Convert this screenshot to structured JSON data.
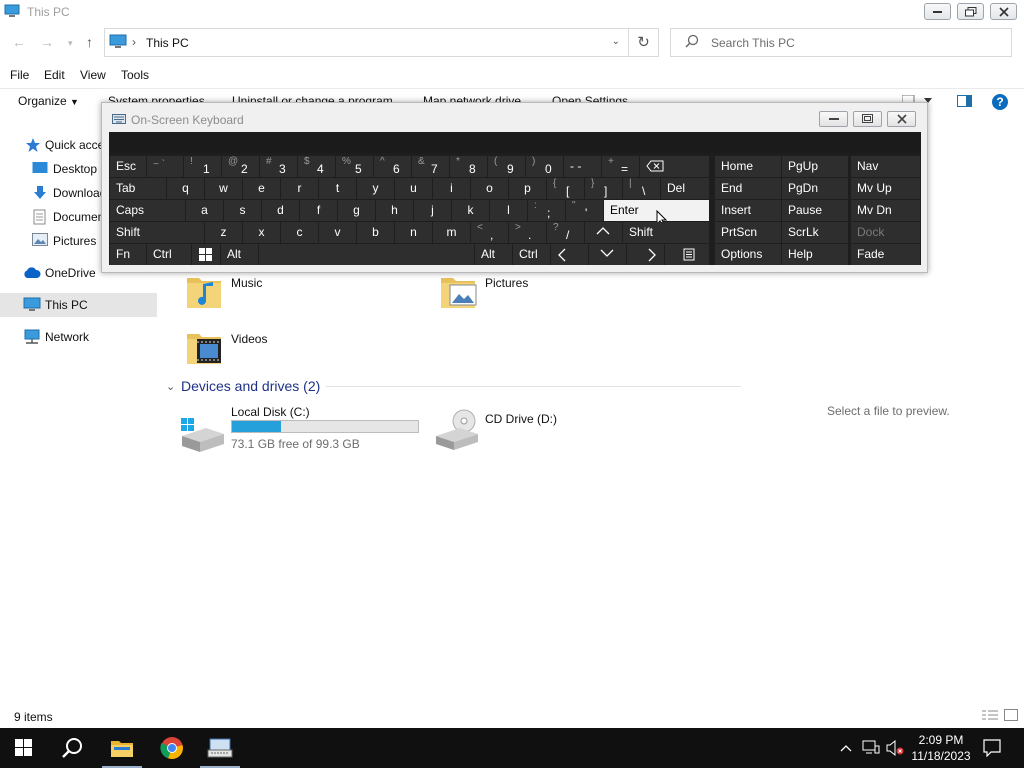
{
  "window": {
    "title": "This PC"
  },
  "address": {
    "path": "This PC",
    "search_placeholder": "Search This PC"
  },
  "menu": [
    "File",
    "Edit",
    "View",
    "Tools"
  ],
  "commands": {
    "organize": "Organize",
    "items": [
      "System properties",
      "Uninstall or change a program",
      "Map network drive",
      "Open Settings"
    ]
  },
  "nav": {
    "quick_access": "Quick access",
    "desktop": "Desktop",
    "downloads": "Downloads",
    "documents": "Documents",
    "pictures": "Pictures",
    "onedrive": "OneDrive",
    "this_pc": "This PC",
    "network": "Network"
  },
  "folders": {
    "music": "Music",
    "pictures": "Pictures",
    "videos": "Videos"
  },
  "devices": {
    "header": "Devices and drives (2)",
    "c_name": "Local Disk (C:)",
    "c_free": "73.1 GB free of 99.3 GB",
    "c_used_fraction": 0.264,
    "d_name": "CD Drive (D:)"
  },
  "preview": "Select a file to preview.",
  "status": {
    "items": "9 items"
  },
  "osk": {
    "title": "On-Screen Keyboard",
    "row1": {
      "esc": "Esc",
      "tilde": "~ `",
      "k1": "1",
      "k2": "2",
      "k3": "3",
      "k4": "4",
      "k5": "5",
      "k6": "6",
      "k7": "7",
      "k8": "8",
      "k9": "9",
      "k0": "0",
      "minus": "- -",
      "eq": "=",
      "s1": "!",
      "s2": "@",
      "s3": "#",
      "s4": "$",
      "s5": "%",
      "s6": "^",
      "s7": "&",
      "s8": "*",
      "s9": "(",
      "s0": ")",
      "splus": "+"
    },
    "row2": {
      "tab": "Tab",
      "q": "q",
      "w": "w",
      "e": "e",
      "r": "r",
      "t": "t",
      "y": "y",
      "u": "u",
      "i": "i",
      "o": "o",
      "p": "p",
      "lb": "[",
      "rb": "]",
      "bs": "\\",
      "del": "Del",
      "slb": "{",
      "srb": "}",
      "sbs": "|"
    },
    "row3": {
      "caps": "Caps",
      "a": "a",
      "s": "s",
      "d": "d",
      "f": "f",
      "g": "g",
      "h": "h",
      "j": "j",
      "k": "k",
      "l": "l",
      "semi": ";",
      "quote": "'",
      "enter": "Enter",
      "scolon": ":",
      "squote": "\""
    },
    "row4": {
      "shift": "Shift",
      "z": "z",
      "x": "x",
      "c": "c",
      "v": "v",
      "b": "b",
      "n": "n",
      "m": "m",
      "comma": ",",
      "period": ".",
      "slash": "/",
      "shift_r": "Shift",
      "slt": "<",
      "sgt": ">",
      "sq": "?"
    },
    "row5": {
      "fn": "Fn",
      "ctrl": "Ctrl",
      "alt": "Alt",
      "alt_r": "Alt",
      "ctrl_r": "Ctrl"
    },
    "nav": {
      "home": "Home",
      "pgup": "PgUp",
      "nav": "Nav",
      "end": "End",
      "pgdn": "PgDn",
      "mvup": "Mv Up",
      "insert": "Insert",
      "pause": "Pause",
      "mvdn": "Mv Dn",
      "prtscn": "PrtScn",
      "scrlk": "ScrLk",
      "dock": "Dock",
      "options": "Options",
      "help": "Help",
      "fade": "Fade"
    }
  },
  "taskbar": {
    "time": "2:09 PM",
    "date": "11/18/2023"
  },
  "colors": {
    "accent": "#26a0da",
    "osk_key": "#2e2e2e",
    "taskbar": "#101010",
    "section_header": "#1e3287"
  }
}
